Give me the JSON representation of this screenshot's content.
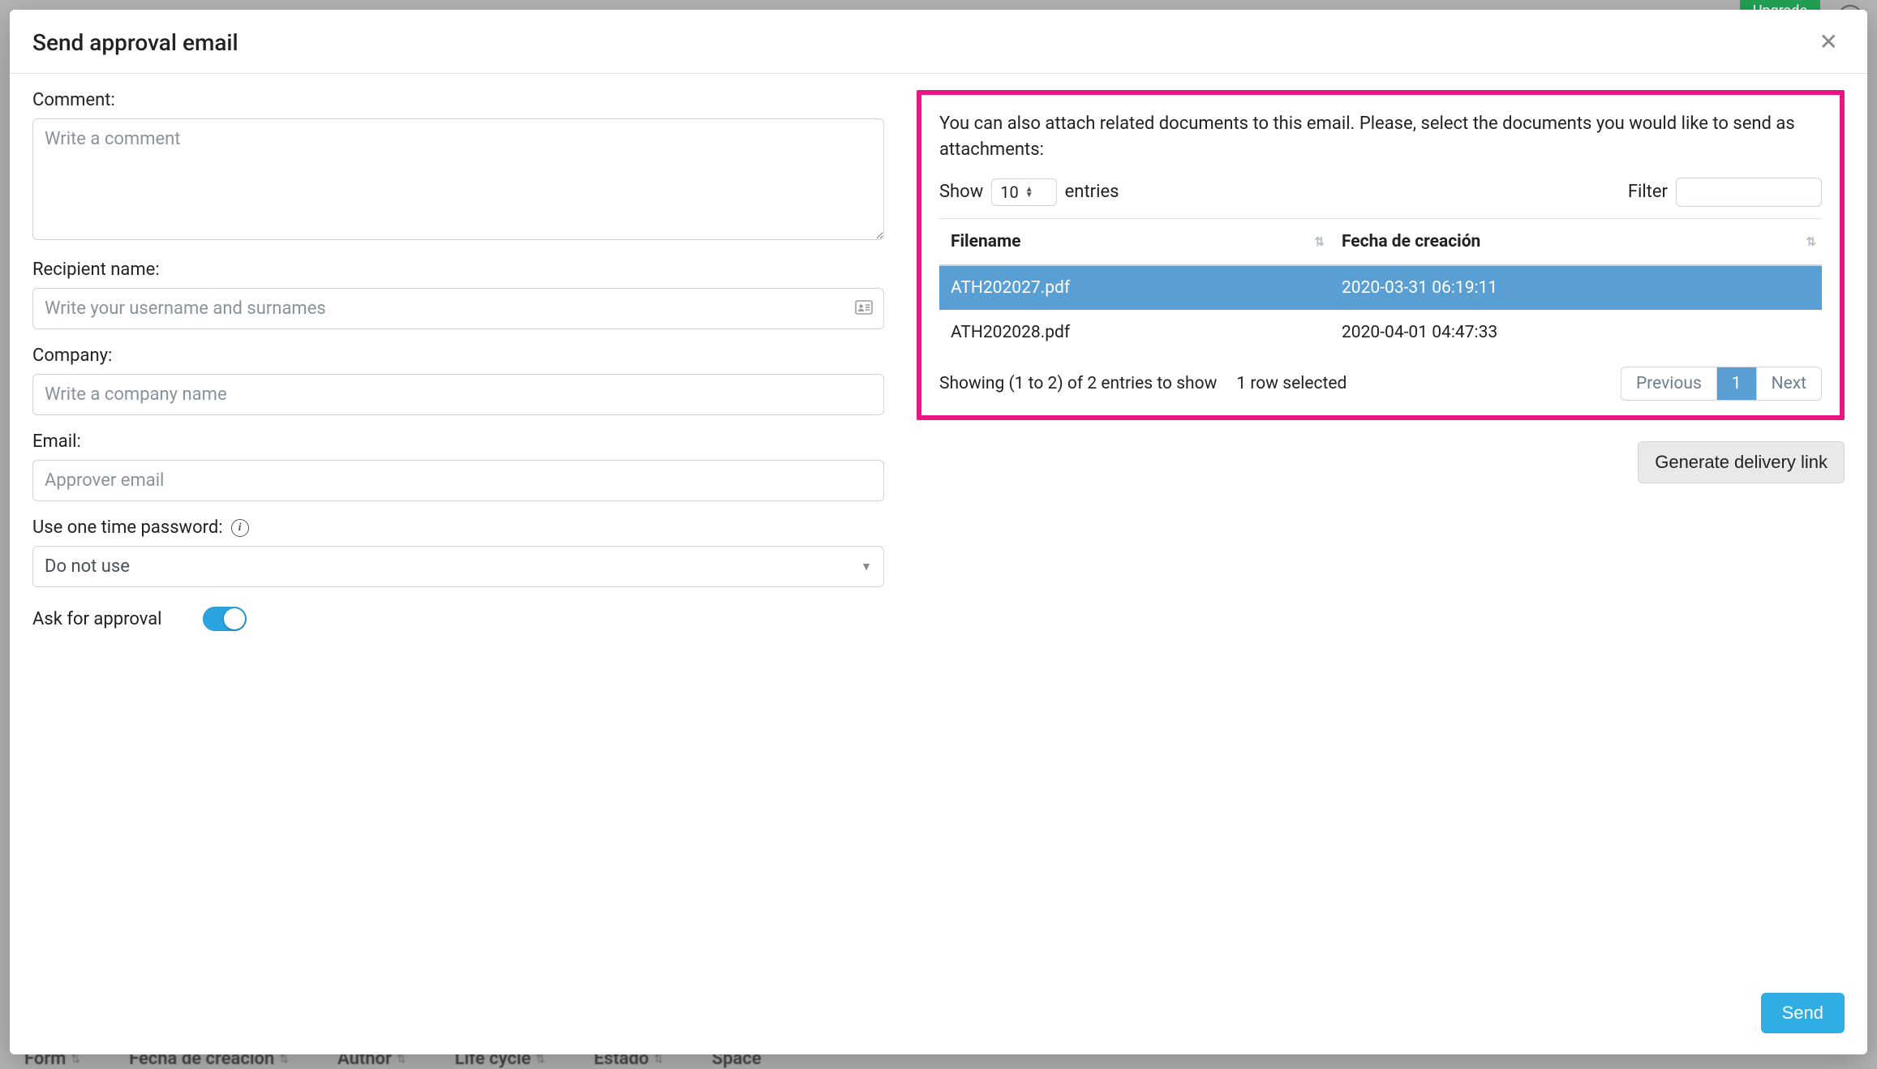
{
  "background": {
    "upgrade_label": "Upgrade",
    "help_glyph": "?",
    "columns": [
      "Form",
      "Fecha de creación",
      "Author",
      "Life cycle",
      "Estado",
      "Space"
    ]
  },
  "modal": {
    "title": "Send approval email",
    "close_glyph": "✕",
    "send_label": "Send"
  },
  "form": {
    "comment_label": "Comment:",
    "comment_placeholder": "Write a comment",
    "recipient_label": "Recipient name:",
    "recipient_placeholder": "Write your username and surnames",
    "company_label": "Company:",
    "company_placeholder": "Write a company name",
    "email_label": "Email:",
    "email_placeholder": "Approver email",
    "otp_label": "Use one time password:",
    "otp_value": "Do not use",
    "approval_label": "Ask for approval",
    "approval_on": true
  },
  "attachments": {
    "intro": "You can also attach related documents to this email. Please, select the documents you would like to send as attachments:",
    "show_label": "Show",
    "entries_label": "entries",
    "entries_value": "10",
    "filter_label": "Filter",
    "columns": {
      "filename": "Filename",
      "created": "Fecha de creación"
    },
    "rows": [
      {
        "filename": "ATH202027.pdf",
        "created": "2020-03-31 06:19:11",
        "selected": true
      },
      {
        "filename": "ATH202028.pdf",
        "created": "2020-04-01 04:47:33",
        "selected": false
      }
    ],
    "showing_text": "Showing (1 to 2) of 2 entries to show",
    "selected_text": "1 row selected",
    "prev_label": "Previous",
    "next_label": "Next",
    "page_current": "1",
    "generate_label": "Generate delivery link"
  }
}
